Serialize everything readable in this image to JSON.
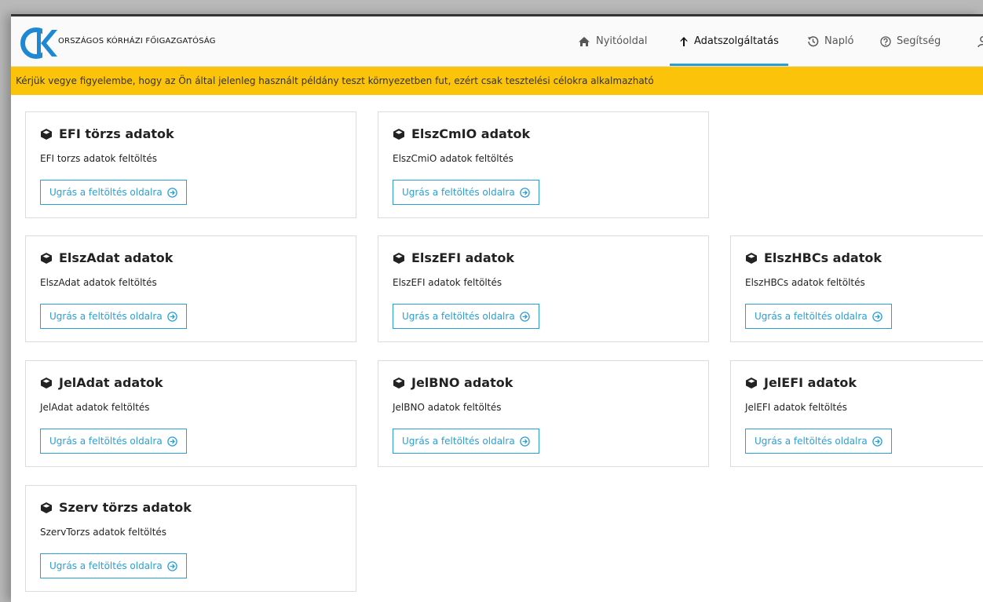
{
  "header": {
    "org_name": "ORSZÁGOS KÓRHÁZI FŐIGAZGATÓSÁG",
    "nav": [
      {
        "label": "Nyitóoldal",
        "icon": "home-icon"
      },
      {
        "label": "Adatszolgáltatás",
        "icon": "arrow-up-icon",
        "active": true
      },
      {
        "label": "Napló",
        "icon": "history-icon"
      },
      {
        "label": "Segítség",
        "icon": "help-icon"
      }
    ]
  },
  "banner": {
    "text": "Kérjük vegye figyelembe, hogy az Ön által jelenleg használt példány teszt környezetben fut, ezért csak tesztelési célokra alkalmazható"
  },
  "cards": [
    {
      "title": "EFI törzs adatok",
      "description": "EFI torzs adatok feltöltés",
      "button": "Ugrás a feltöltés oldalra"
    },
    {
      "title": "ElszCmIO adatok",
      "description": "ElszCmiO adatok feltöltés",
      "button": "Ugrás a feltöltés oldalra"
    },
    {
      "title": "ElszAdat adatok",
      "description": "ElszAdat adatok feltöltés",
      "button": "Ugrás a feltöltés oldalra"
    },
    {
      "title": "ElszEFI adatok",
      "description": "ElszEFI adatok feltöltés",
      "button": "Ugrás a feltöltés oldalra"
    },
    {
      "title": "ElszHBCs adatok",
      "description": "ElszHBCs adatok feltöltés",
      "button": "Ugrás a feltöltés oldalra"
    },
    {
      "title": "JelAdat adatok",
      "description": "JelAdat adatok feltöltés",
      "button": "Ugrás a feltöltés oldalra"
    },
    {
      "title": "JelBNO adatok",
      "description": "JelBNO adatok feltöltés",
      "button": "Ugrás a feltöltés oldalra"
    },
    {
      "title": "JelEFI adatok",
      "description": "JelEFI adatok feltöltés",
      "button": "Ugrás a feltöltés oldalra"
    },
    {
      "title": "Szerv törzs adatok",
      "description": "SzervTorzs adatok feltöltés",
      "button": "Ugrás a feltöltés oldalra"
    }
  ],
  "colors": {
    "accent": "#2a9fd6",
    "banner": "#fcc30b",
    "logo_blue": "#1e88d3"
  }
}
